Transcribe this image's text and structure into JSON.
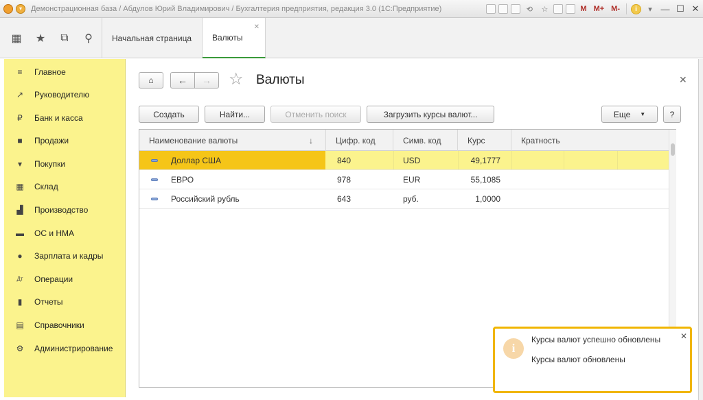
{
  "window": {
    "title": "Демонстрационная база / Абдулов Юрий Владимирович / Бухгалтерия предприятия, редакция 3.0  (1С:Предприятие)",
    "tools": [
      "M",
      "M+",
      "M-"
    ]
  },
  "tabs": [
    {
      "label": "Начальная страница"
    },
    {
      "label": "Валюты"
    }
  ],
  "sidebar": {
    "items": [
      {
        "label": "Главное",
        "icon": "menu-icon"
      },
      {
        "label": "Руководителю",
        "icon": "trend-icon"
      },
      {
        "label": "Банк и касса",
        "icon": "ruble-icon"
      },
      {
        "label": "Продажи",
        "icon": "bag-icon"
      },
      {
        "label": "Покупки",
        "icon": "cart-icon"
      },
      {
        "label": "Склад",
        "icon": "warehouse-icon"
      },
      {
        "label": "Производство",
        "icon": "factory-icon"
      },
      {
        "label": "ОС и НМА",
        "icon": "truck-icon"
      },
      {
        "label": "Зарплата и кадры",
        "icon": "person-icon"
      },
      {
        "label": "Операции",
        "icon": "debit-credit-icon"
      },
      {
        "label": "Отчеты",
        "icon": "bar-chart-icon"
      },
      {
        "label": "Справочники",
        "icon": "book-icon"
      },
      {
        "label": "Администрирование",
        "icon": "gear-icon"
      }
    ]
  },
  "form": {
    "title": "Валюты",
    "buttons": {
      "create": "Создать",
      "find": "Найти...",
      "cancel_search": "Отменить поиск",
      "load_rates": "Загрузить курсы валют...",
      "more": "Еще",
      "help": "?"
    }
  },
  "table": {
    "columns": [
      "Наименование валюты",
      "Цифр. код",
      "Симв. код",
      "Курс",
      "Кратность"
    ],
    "rows": [
      {
        "name": "Доллар США",
        "digital_code": "840",
        "symbol_code": "USD",
        "rate": "49,1777",
        "multiplicity": ""
      },
      {
        "name": "ЕВРО",
        "digital_code": "978",
        "symbol_code": "EUR",
        "rate": "55,1085",
        "multiplicity": ""
      },
      {
        "name": "Российский рубль",
        "digital_code": "643",
        "symbol_code": "руб.",
        "rate": "1,0000",
        "multiplicity": ""
      }
    ]
  },
  "notification": {
    "title": "Курсы валют успешно обновлены",
    "text": "Курсы валют обновлены",
    "icon": "info-icon"
  },
  "colors": {
    "sidebar_bg": "#fbf38d",
    "selected_row": "#fbf38d",
    "current_cell": "#f5c518",
    "notify_border": "#f0b500",
    "active_tab_underline": "#3a9a3a"
  }
}
